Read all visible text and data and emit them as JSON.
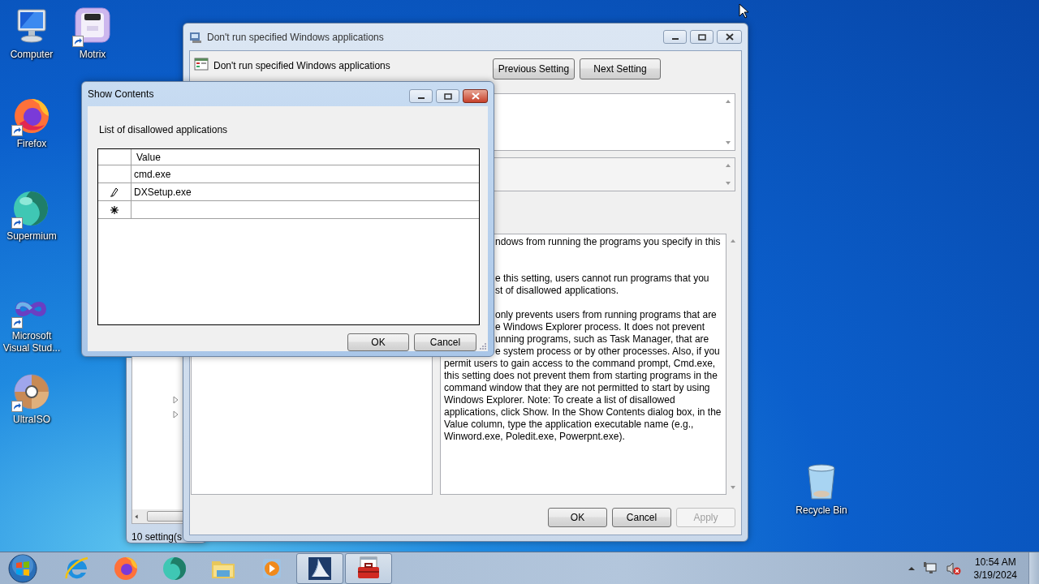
{
  "desktop_icons": [
    {
      "kind": "computer",
      "label": "Computer",
      "shortcut": false
    },
    {
      "kind": "motrix",
      "label": "Motrix",
      "shortcut": true
    },
    {
      "kind": "firefox",
      "label": "Firefox",
      "shortcut": true
    },
    {
      "kind": "supermium",
      "label": "Supermium",
      "shortcut": true
    },
    {
      "kind": "vs",
      "label": "Microsoft Visual Stud...",
      "shortcut": true
    },
    {
      "kind": "disc",
      "label": "UltraISO",
      "shortcut": true
    },
    {
      "kind": "recycle",
      "label": "Recycle Bin",
      "shortcut": false
    }
  ],
  "background_window": {
    "status": "10 setting(s"
  },
  "policy_window": {
    "title": "Don't run specified Windows applications",
    "setting_name": "Don't run specified Windows applications",
    "nav_buttons": [
      {
        "label": "Previous Setting"
      },
      {
        "label": "Next Setting"
      }
    ],
    "help_lines": [
      {
        "kind": "fragment",
        "text": "ndows from running the programs you specify in this"
      },
      {
        "kind": "blank"
      },
      {
        "kind": "blank"
      },
      {
        "kind": "fragment",
        "text": "e this setting, users cannot run programs that you"
      },
      {
        "kind": "fragment",
        "text": "st of disallowed applications."
      },
      {
        "kind": "blank"
      },
      {
        "kind": "fragment",
        "text": "only prevents users from running programs that are"
      },
      {
        "kind": "fragment",
        "text": "e Windows Explorer process. It does not prevent"
      },
      {
        "kind": "fragment",
        "text": "unning programs, such as Task Manager, that are"
      },
      {
        "kind": "fragment",
        "text": "e system process or by other processes. Also, if you"
      },
      {
        "kind": "full",
        "text": "permit users to gain access to the command prompt, Cmd.exe,"
      },
      {
        "kind": "full",
        "text": "this setting does not prevent them from starting programs in the"
      },
      {
        "kind": "full",
        "text": "command window that they are not permitted to start by using"
      },
      {
        "kind": "full",
        "text": "Windows Explorer. Note: To create a list of disallowed"
      },
      {
        "kind": "full",
        "text": "applications, click Show. In the Show Contents dialog box, in the"
      },
      {
        "kind": "full",
        "text": "Value column, type the application executable name (e.g.,"
      },
      {
        "kind": "full",
        "text": "Winword.exe, Poledit.exe, Powerpnt.exe)."
      }
    ],
    "buttons": [
      {
        "label": "OK",
        "disabled": false
      },
      {
        "label": "Cancel",
        "disabled": false
      },
      {
        "label": "Apply",
        "disabled": true
      }
    ]
  },
  "dialog": {
    "title": "Show Contents",
    "caption": "List of disallowed applications",
    "column": "Value",
    "rows": [
      {
        "kind": "plain",
        "value": "cmd.exe"
      },
      {
        "kind": "editing",
        "value": "DXSetup.exe"
      },
      {
        "kind": "new"
      }
    ],
    "buttons": [
      {
        "label": "OK"
      },
      {
        "label": "Cancel"
      }
    ]
  },
  "taskbar": {
    "apps": [
      {
        "kind": "ie",
        "active": false
      },
      {
        "kind": "firefox",
        "active": false
      },
      {
        "kind": "supermium",
        "active": false
      },
      {
        "kind": "folder",
        "active": false
      },
      {
        "kind": "media",
        "active": false
      },
      {
        "kind": "sail",
        "active": true
      },
      {
        "kind": "toolbox",
        "active": true
      }
    ],
    "time": "10:54 AM",
    "date": "3/19/2024"
  }
}
